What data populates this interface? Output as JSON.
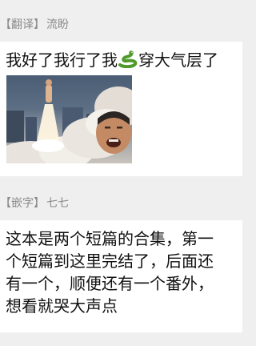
{
  "messages": [
    {
      "tag": "【翻译】",
      "sender": "流盼",
      "text": "我好了我行了我",
      "emoji": "snake-emoji",
      "text_after": "穿大气层了"
    },
    {
      "tag": "【嵌字】",
      "sender": "七七",
      "lines": [
        "这本是两个短篇的合集，第一",
        "个短篇到这里完结了，后面还",
        "有一个，顺便还有一个番外，",
        "想看就哭大声点"
      ]
    }
  ]
}
